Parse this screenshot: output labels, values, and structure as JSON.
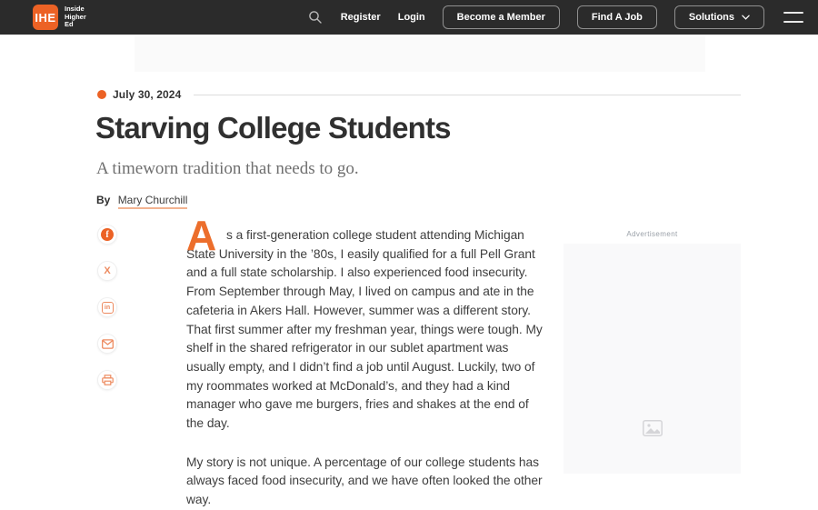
{
  "header": {
    "logo_monogram": "IHE",
    "logo_wordmark": [
      "Inside",
      "Higher",
      "Ed"
    ],
    "register_label": "Register",
    "login_label": "Login",
    "member_button_label": "Become a Member",
    "job_button_label": "Find A Job",
    "solutions_button_label": "Solutions"
  },
  "article": {
    "date": "July 30, 2024",
    "title": "Starving College Students",
    "dek": "A timeworn tradition that needs to go.",
    "byline_prefix": "By",
    "author": "Mary Churchill",
    "dropcap": "A",
    "body_paragraph_1": "s a first-generation college student attending Michigan State University in the ’80s, I easily qualified for a full Pell Grant and a full state scholarship. I also experienced food insecurity. From September through May, I lived on campus and ate in the cafeteria in Akers Hall. However, summer was a different story. That first summer after my freshman year, things were tough. My shelf in the shared refrigerator in our sublet apartment was usually empty, and I didn’t find a job until August. Luckily, two of my roommates worked at McDonald’s, and they had a kind manager who gave me burgers, fries and shakes at the end of the day.",
    "body_paragraph_2": "My story is not unique. A percentage of our college students has always faced food insecurity, and we have often looked the other way."
  },
  "share": {
    "facebook_glyph": "f",
    "x_glyph": "X",
    "linkedin_glyph": "in"
  },
  "ads": {
    "right_label": "Advertisement"
  },
  "icons": {
    "search": "magnifying-glass",
    "menu": "hamburger-two-bars",
    "solutions_chevron": "chevron-down",
    "share": [
      "facebook",
      "x-twitter",
      "linkedin",
      "email",
      "print"
    ],
    "ad_placeholder": "image-placeholder"
  },
  "colors": {
    "accent_orange": "#EC6225",
    "header_bg": "#2B2B2B",
    "headline_text": "#303030",
    "body_text": "#3E3E3E",
    "ad_bg": "#F9F9FA"
  }
}
